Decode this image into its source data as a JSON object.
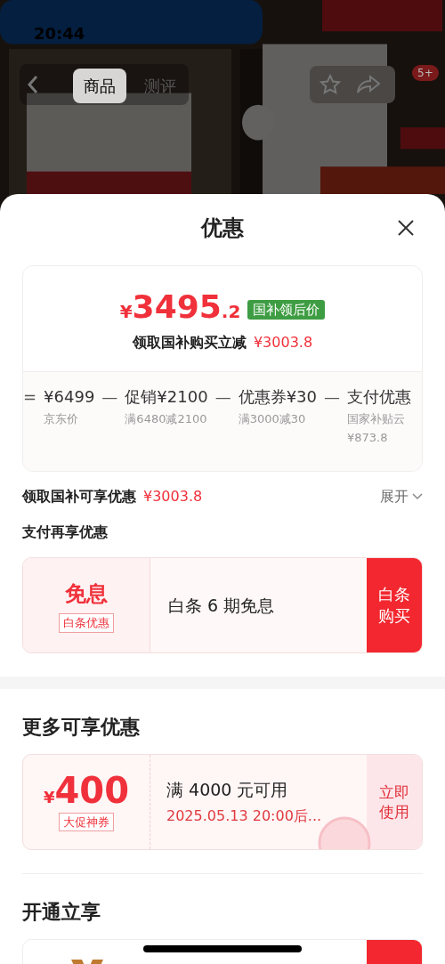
{
  "status_bar": {
    "time": "20:44"
  },
  "top_tabs": [
    {
      "label": "商品",
      "selected": true
    },
    {
      "label": "测评",
      "selected": false
    }
  ],
  "cart_badge": "5+",
  "sheet": {
    "title": "优惠",
    "price_card": {
      "currency": "¥",
      "integer": "3495",
      "decimal": ".2",
      "tag": "国补领后价",
      "subtitle": "领取国补购买立减",
      "subtitle_amount": "¥3003.8",
      "breakdown": [
        {
          "operator": "=",
          "amount": "¥6499",
          "notes": [
            "京东价"
          ]
        },
        {
          "operator": "—",
          "label": "促销",
          "amount": "¥2100",
          "notes": [
            "满6480减2100"
          ]
        },
        {
          "operator": "—",
          "label": "优惠券",
          "amount": "¥30",
          "notes": [
            "满3000减30"
          ]
        },
        {
          "operator": "—",
          "label": "支付优惠",
          "notes": [
            "国家补贴云",
            "¥873.8"
          ]
        }
      ]
    },
    "subsidy_row": {
      "label": "领取国补可享优惠",
      "amount": "¥3003.8",
      "toggle": "展开",
      "expanded": false
    },
    "pay_section": {
      "title": "支付再享优惠",
      "badge": "免息",
      "tag": "白条优惠",
      "text": "白条 6 期免息",
      "button": "白条购买"
    },
    "more_section": {
      "title": "更多可享优惠",
      "coupon": {
        "currency": "¥",
        "amount": "400",
        "tag": "大促神券",
        "condition": "满 4000 元可用",
        "validity": "2025.05.13 20:00后...",
        "button": "立即使用",
        "claimed": true
      }
    },
    "open_section": {
      "title": "开通立享"
    }
  }
}
